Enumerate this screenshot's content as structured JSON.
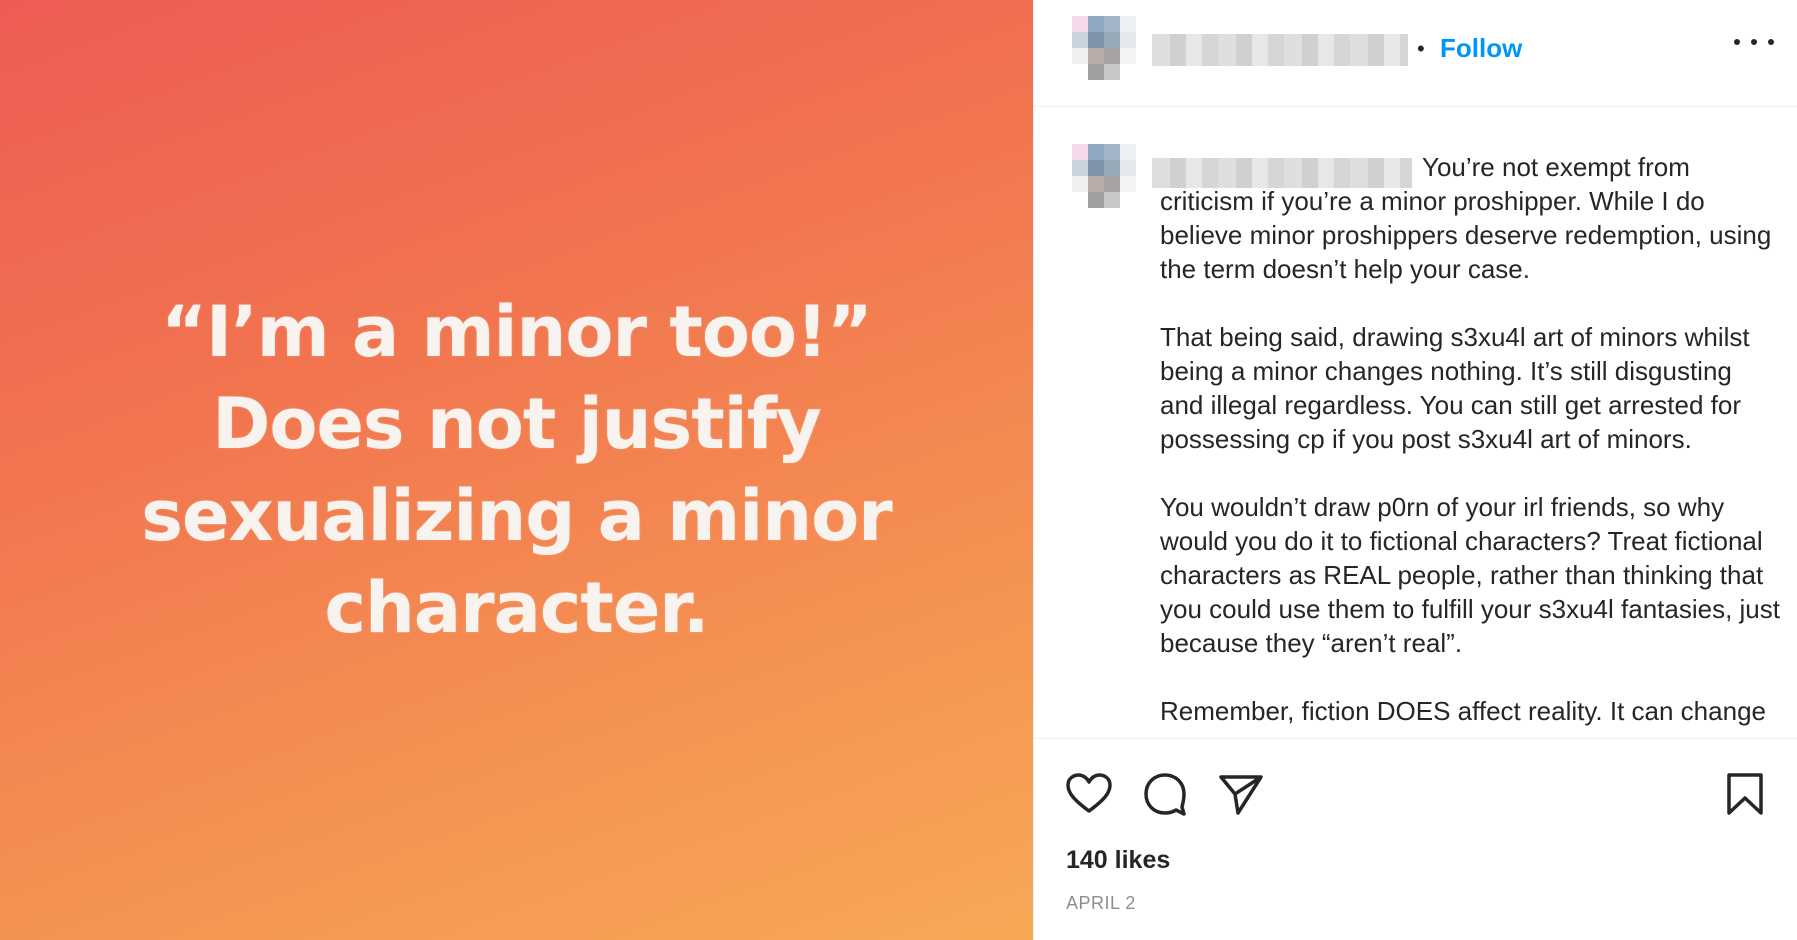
{
  "media": {
    "text": "“I’m a minor too!” Does not justify sexualizing a minor character."
  },
  "header": {
    "separator": "•",
    "follow_label": "Follow",
    "more_icon": "more-horizontal-icon"
  },
  "caption": {
    "text": "You’re not exempt from criticism if you’re a minor proshipper. While I do believe minor proshippers deserve redemption, using the term doesn’t help your case.\n\nThat being said, drawing s3xu4l art of minors whilst being a minor changes nothing. It’s still disgusting and illegal regardless. You can still get arrested for possessing cp if you post s3xu4l art of minors.\n\nYou wouldn’t draw p0rn of your irl friends, so why would you do it to fictional characters? Treat fictional characters as REAL people, rather than thinking that you could use them to fulfill your s3xu4l fantasies, just because they “aren’t real”.\n\nRemember, fiction DOES affect reality. It can change"
  },
  "actions": {
    "like_icon": "heart-icon",
    "comment_icon": "comment-icon",
    "share_icon": "paper-plane-icon",
    "save_icon": "bookmark-icon"
  },
  "stats": {
    "likes": "140 likes",
    "date": "APRIL 2"
  },
  "colors": {
    "accent": "#0095f6",
    "gradient_start": "#ee5b55",
    "gradient_end": "#f7a955"
  }
}
